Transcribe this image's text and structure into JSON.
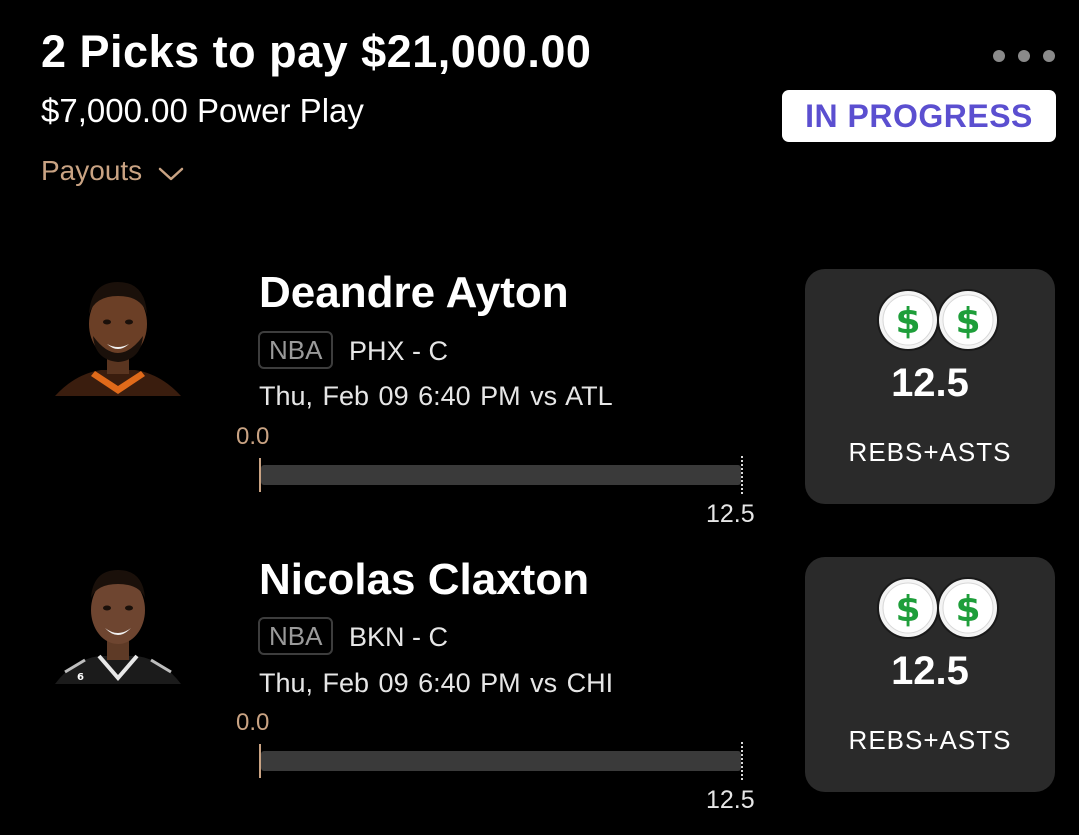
{
  "header": {
    "title": "2 Picks to pay $21,000.00",
    "subtitle": "$7,000.00 Power Play",
    "payouts_label": "Payouts",
    "status": "IN PROGRESS",
    "more_icon": "ellipsis-icon"
  },
  "colors": {
    "background": "#000000",
    "accent": "#c9a383",
    "status_text": "#5b4fd0",
    "card": "#2a2a2a",
    "dollar_green": "#1e9e3a"
  },
  "picks": [
    {
      "player": "Deandre Ayton",
      "league": "NBA",
      "team_position": "PHX - C",
      "game": "Thu, Feb 09 6:40 PM  vs ATL",
      "current": "0.0",
      "goal": "12.5",
      "progress_fraction": 0,
      "card_line": "12.5",
      "card_stat": "REBS+ASTS",
      "card_icons": [
        "dollar-coin-icon",
        "dollar-coin-icon"
      ]
    },
    {
      "player": "Nicolas Claxton",
      "league": "NBA",
      "team_position": "BKN - C",
      "game": "Thu, Feb 09 6:40 PM  vs CHI",
      "current": "0.0",
      "goal": "12.5",
      "progress_fraction": 0,
      "card_line": "12.5",
      "card_stat": "REBS+ASTS",
      "card_icons": [
        "dollar-coin-icon",
        "dollar-coin-icon"
      ]
    }
  ]
}
